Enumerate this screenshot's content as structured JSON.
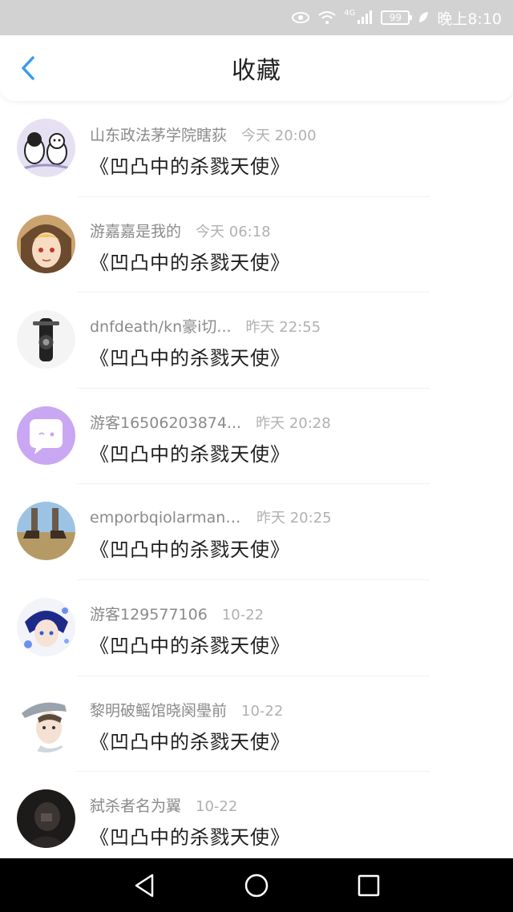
{
  "status_bar": {
    "battery": "99",
    "network": "4G",
    "time": "晚上8:10",
    "icons": [
      "eye-icon",
      "wifi-icon",
      "signal-icon",
      "battery-icon",
      "leaf-icon"
    ]
  },
  "header": {
    "title": "收藏",
    "back_icon": "chevron-left-icon",
    "accent_color": "#3a9bea"
  },
  "favorites": [
    {
      "user": "山东政法茅学院瞎荻",
      "time": "今天 20:00",
      "content": "《凹凸中的杀戮天使》",
      "avatar": "cartoon-cats"
    },
    {
      "user": "游嘉嘉是我的",
      "time": "今天 06:18",
      "content": "《凹凸中的杀戮天使》",
      "avatar": "anime-girl"
    },
    {
      "user": "dnfdeath/kn豪i切...",
      "time": "昨天 22:55",
      "content": "《凹凸中的杀戮天使》",
      "avatar": "motorcycle"
    },
    {
      "user": "游客16506203874...",
      "time": "昨天 20:28",
      "content": "《凹凸中的杀戮天使》",
      "avatar": "chat-bubble"
    },
    {
      "user": "emporbqiolarmannit",
      "time": "昨天 20:25",
      "content": "《凹凸中的杀戮天使》",
      "avatar": "boots-field"
    },
    {
      "user": "游客129577106",
      "time": "10-22",
      "content": "《凹凸中的杀戮天使》",
      "avatar": "anime-boy-blue"
    },
    {
      "user": "黎明破鳐馆晓阕璺前",
      "time": "10-22",
      "content": "《凹凸中的杀戮天使》",
      "avatar": "boy-cap"
    },
    {
      "user": "弑杀者名为翼",
      "time": "10-22",
      "content": "《凹凸中的杀戮天使》",
      "avatar": "dark-figure"
    }
  ],
  "nav_bar": {
    "buttons": [
      "back-triangle-icon",
      "home-circle-icon",
      "recents-square-icon"
    ]
  }
}
